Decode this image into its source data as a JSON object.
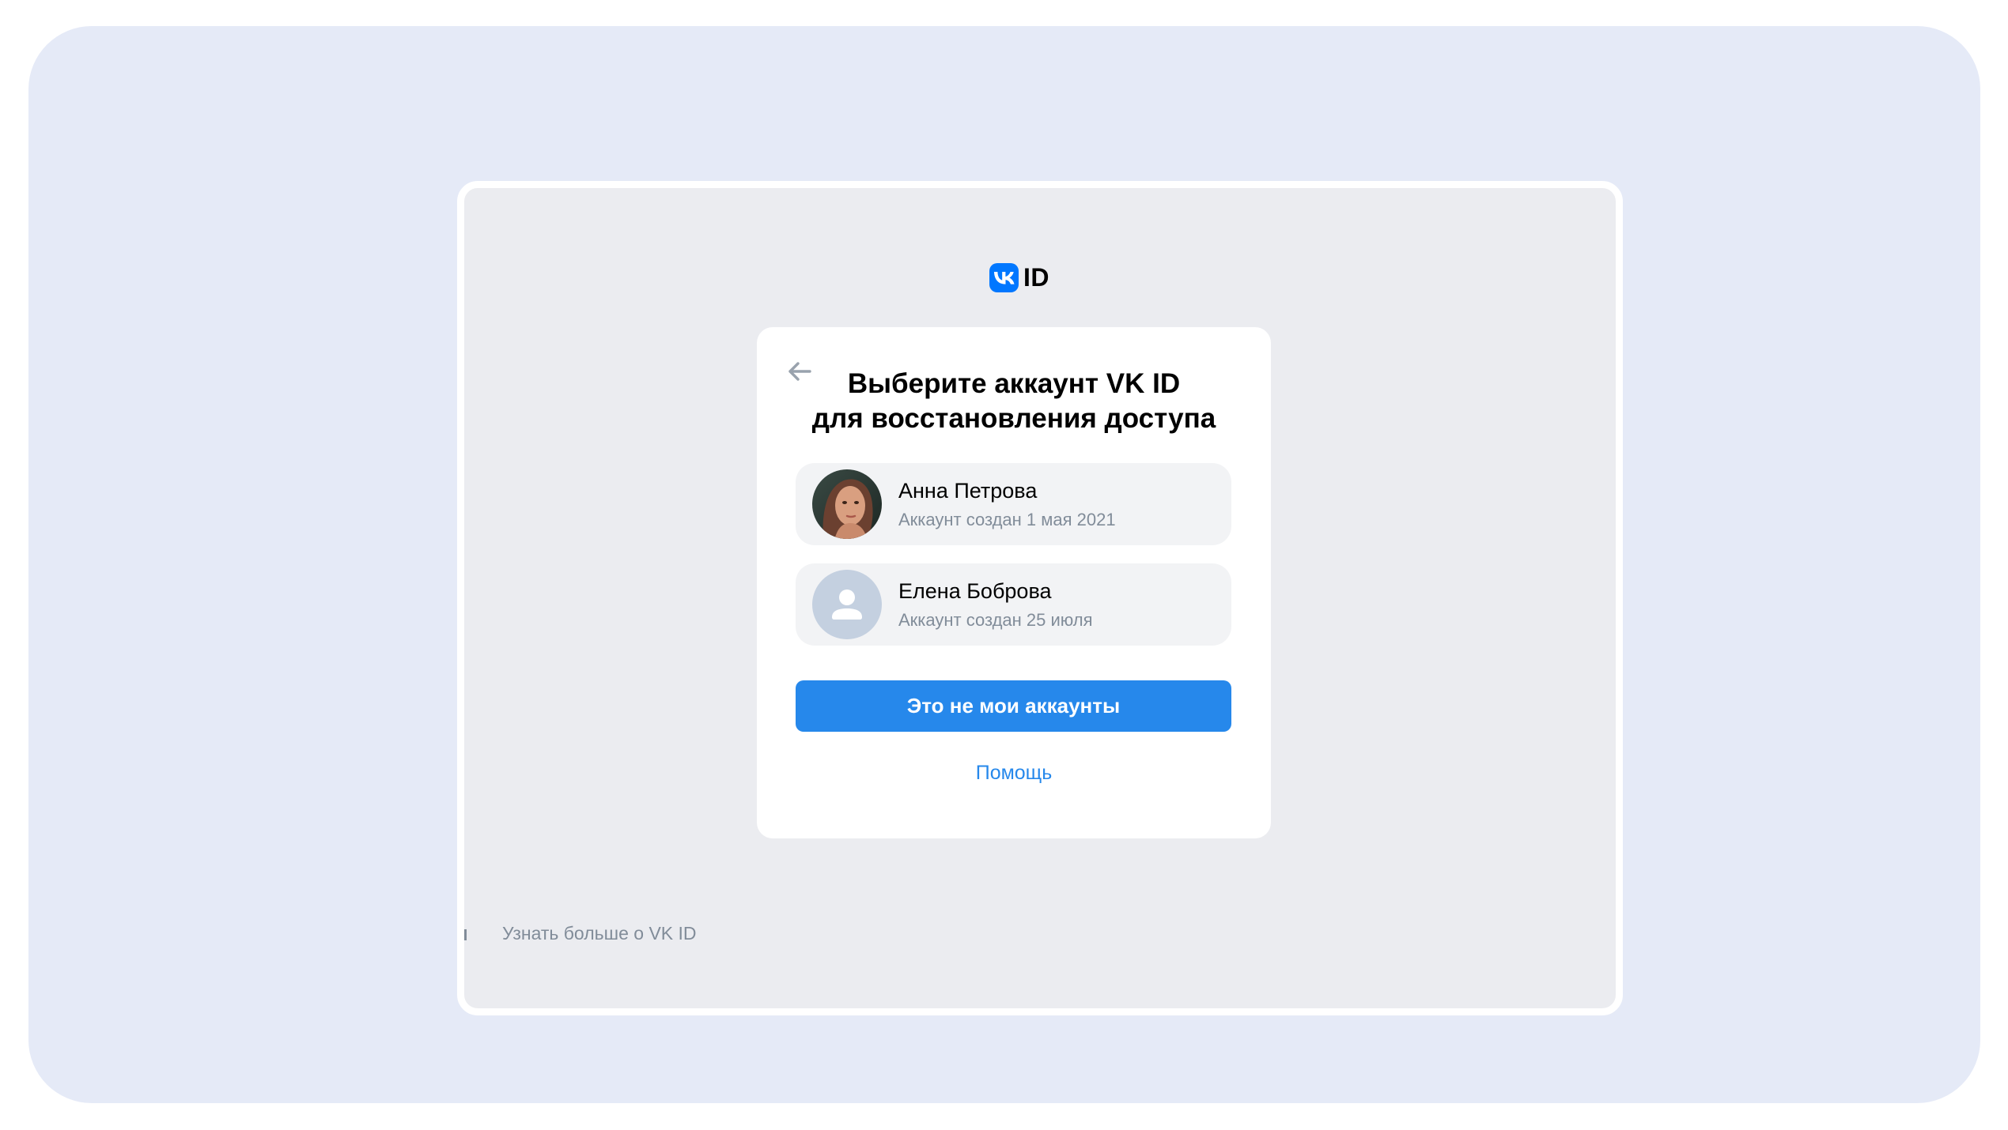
{
  "logo": {
    "text": "ID"
  },
  "card": {
    "title_line1": "Выберите аккаунт VK ID",
    "title_line2": "для восстановления доступа",
    "accounts": [
      {
        "name": "Анна Петрова",
        "subtitle": "Аккаунт создан 1 мая 2021"
      },
      {
        "name": "Елена Боброва",
        "subtitle": "Аккаунт создан 25 июля"
      }
    ],
    "primary_button": "Это не мои аккаунты",
    "help_link": "Помощь"
  },
  "footer": {
    "link": "Узнать больше о VK ID"
  },
  "colors": {
    "accent": "#2688eb",
    "brand": "#0077ff",
    "page_bg": "#e5eaf7",
    "frame_bg": "#ebecf0",
    "secondary_text": "#818c99"
  }
}
